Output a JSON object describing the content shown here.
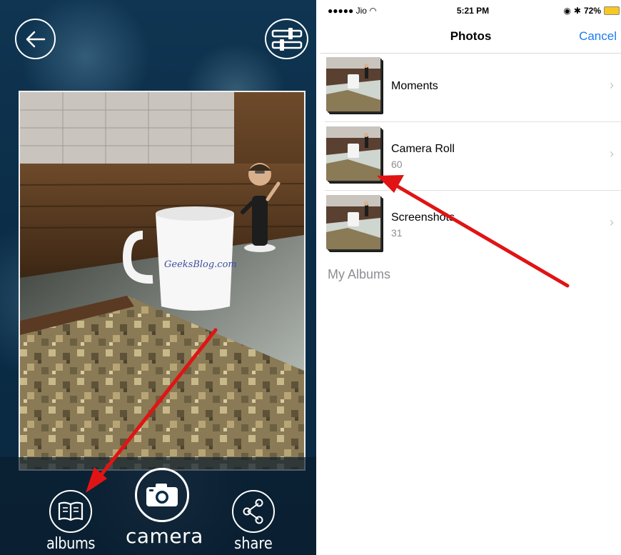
{
  "left_panel": {
    "back_icon": "back-arrow-icon",
    "settings_icon": "sliders-icon",
    "photo_watermark": "GeeksBlog.com",
    "bottom_bar": {
      "albums": {
        "label": "albums",
        "icon": "book-icon"
      },
      "camera": {
        "label": "camera",
        "icon": "camera-icon"
      },
      "share": {
        "label": "share",
        "icon": "share-icon"
      }
    }
  },
  "right_panel": {
    "status_bar": {
      "carrier": "●●●●● Jio",
      "time": "5:21 PM",
      "battery": "72%"
    },
    "nav": {
      "title": "Photos",
      "cancel": "Cancel"
    },
    "albums": [
      {
        "name": "Moments",
        "count": ""
      },
      {
        "name": "Camera Roll",
        "count": "60"
      },
      {
        "name": "Screenshots",
        "count": "31"
      }
    ],
    "section_header": "My Albums"
  },
  "colors": {
    "accent": "#1a7cf2",
    "arrow": "#e01414",
    "battery": "#f7c920"
  }
}
